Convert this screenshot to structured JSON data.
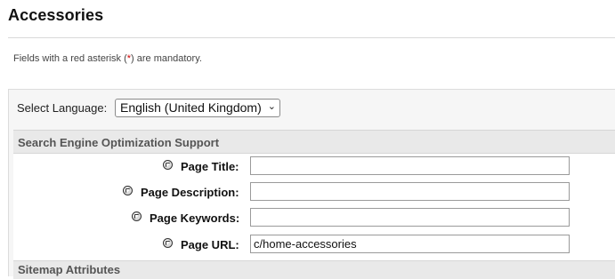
{
  "page": {
    "title": "Accessories",
    "mandatory_note": {
      "before": "Fields with a red asterisk (",
      "asterisk": "*",
      "after": ") are mandatory."
    }
  },
  "language": {
    "label": "Select Language:",
    "selected": "English (United Kingdom)"
  },
  "seo": {
    "header": "Search Engine Optimization Support",
    "fields": [
      {
        "label": "Page Title:",
        "value": ""
      },
      {
        "label": "Page Description:",
        "value": ""
      },
      {
        "label": "Page Keywords:",
        "value": ""
      },
      {
        "label": "Page URL:",
        "value": "c/home-accessories"
      }
    ]
  },
  "sitemap": {
    "header": "Sitemap Attributes"
  },
  "colors": {
    "asterisk": "#d00000",
    "section_header_bg": "#e9e9e9",
    "panel_bg": "#f6f6f6"
  },
  "icons": {
    "field_help": "help-icon"
  }
}
